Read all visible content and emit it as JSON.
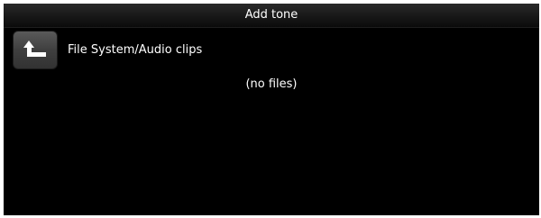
{
  "header": {
    "title": "Add tone"
  },
  "navigation": {
    "up_icon": "folder-up-icon",
    "current_path": "File System/Audio clips"
  },
  "file_list": {
    "empty_text": "(no files)"
  }
}
